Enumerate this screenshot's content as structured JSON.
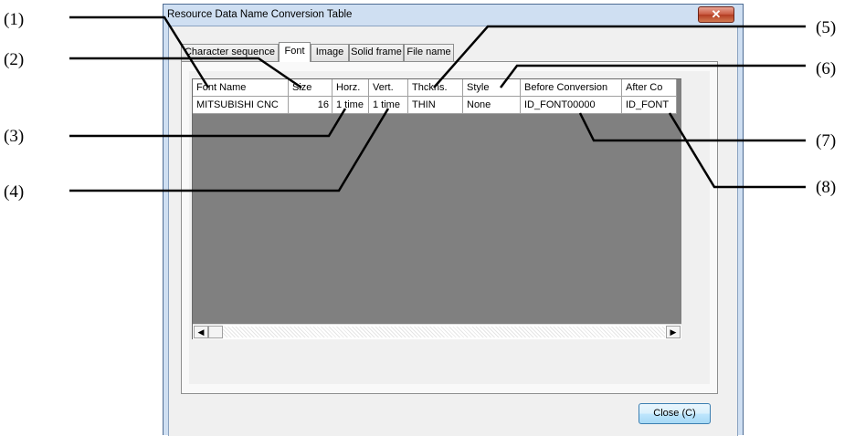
{
  "callouts": [
    "(1)",
    "(2)",
    "(3)",
    "(4)",
    "(5)",
    "(6)",
    "(7)",
    "(8)"
  ],
  "window": {
    "title": "Resource Data Name Conversion Table",
    "close_glyph": "✕",
    "close_icon": "close-icon"
  },
  "tabs": [
    {
      "label": "Character sequence",
      "active": false
    },
    {
      "label": "Font",
      "active": true
    },
    {
      "label": "Image",
      "active": false
    },
    {
      "label": "Solid frame",
      "active": false
    },
    {
      "label": "File name",
      "active": false
    }
  ],
  "table": {
    "headers": [
      "Font Name",
      "Size",
      "Horz.",
      "Vert.",
      "Thckns.",
      "Style",
      "Before Conversion",
      "After Co"
    ],
    "rows": [
      [
        "MITSUBISHI CNC",
        "16",
        "1 time",
        "1 time",
        "THIN",
        "None",
        "ID_FONT00000",
        "ID_FONT"
      ]
    ]
  },
  "scrollbar": {
    "left_arrow": "◀",
    "right_arrow": "▶"
  },
  "buttons": {
    "close_label": "Close (C)"
  },
  "colors": {
    "window_frame": "#cfdff2",
    "grid_background": "#808080",
    "close_button_red": "#c9583f"
  }
}
